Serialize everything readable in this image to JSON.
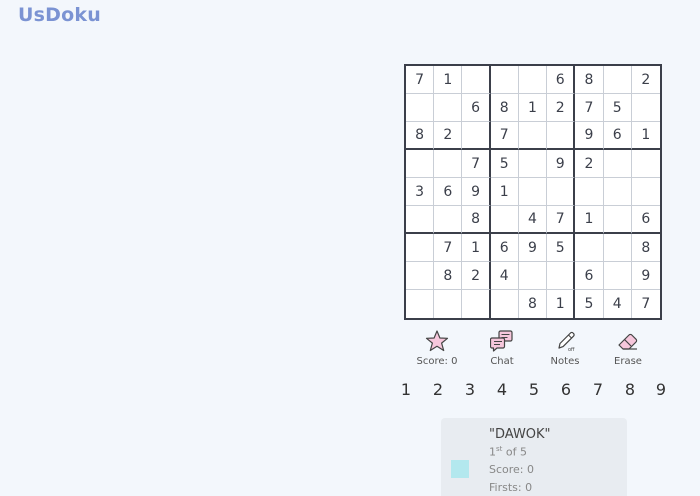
{
  "app": {
    "title": "UsDoku"
  },
  "board": [
    [
      "7",
      "1",
      "",
      "",
      "",
      "6",
      "8",
      "",
      "2"
    ],
    [
      "",
      "",
      "6",
      "8",
      "1",
      "2",
      "7",
      "5",
      ""
    ],
    [
      "8",
      "2",
      "",
      "7",
      "",
      "",
      "9",
      "6",
      "1"
    ],
    [
      "",
      "",
      "7",
      "5",
      "",
      "9",
      "2",
      "",
      ""
    ],
    [
      "3",
      "6",
      "9",
      "1",
      "",
      "",
      "",
      "",
      ""
    ],
    [
      "",
      "",
      "8",
      "",
      "4",
      "7",
      "1",
      "",
      "6"
    ],
    [
      "",
      "7",
      "1",
      "6",
      "9",
      "5",
      "",
      "",
      "8"
    ],
    [
      "",
      "8",
      "2",
      "4",
      "",
      "",
      "6",
      "",
      "9"
    ],
    [
      "",
      "",
      "",
      "",
      "8",
      "1",
      "5",
      "4",
      "7"
    ]
  ],
  "tools": {
    "score_label": "Score: 0",
    "chat_label": "Chat",
    "notes_label": "Notes",
    "erase_label": "Erase",
    "accent": "#e7a4c4"
  },
  "numpad": [
    "1",
    "2",
    "3",
    "4",
    "5",
    "6",
    "7",
    "8",
    "9"
  ],
  "player": {
    "name": "\"DAWOK\"",
    "rank_num": "1",
    "rank_sup": "st",
    "rank_rest": " of 5",
    "score": "Score: 0",
    "firsts": "Firsts: 0",
    "color": "#b3e8ee"
  }
}
